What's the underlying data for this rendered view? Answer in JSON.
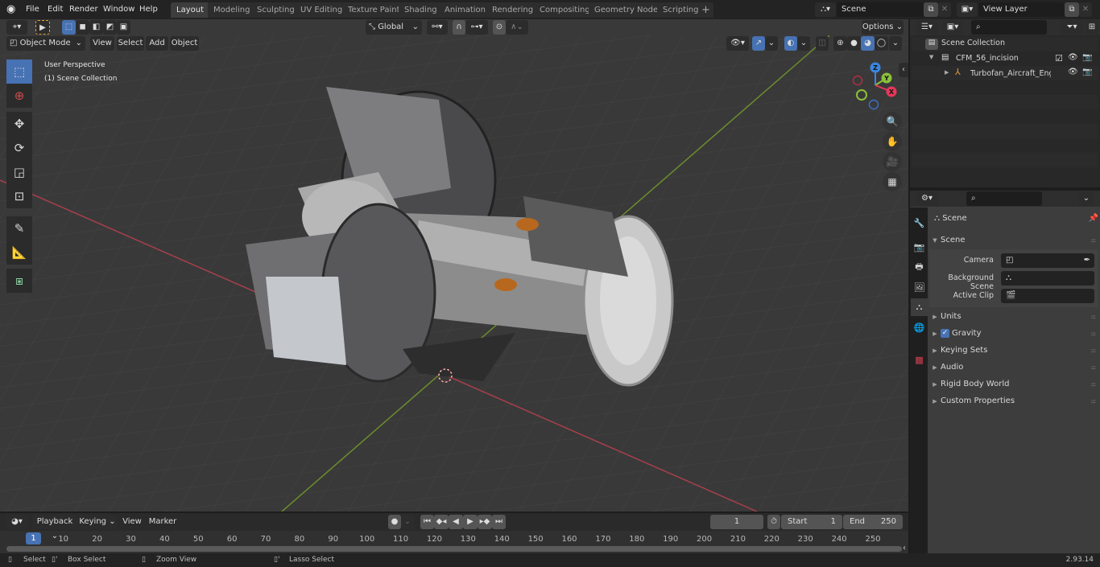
{
  "app": {
    "version": "2.93.14"
  },
  "topbar": {
    "menus": [
      "File",
      "Edit",
      "Render",
      "Window",
      "Help"
    ],
    "workspaces": [
      "Layout",
      "Modeling",
      "Sculpting",
      "UV Editing",
      "Texture Paint",
      "Shading",
      "Animation",
      "Rendering",
      "Compositing",
      "Geometry Nodes",
      "Scripting"
    ],
    "active_workspace": "Layout",
    "add_tab": "+",
    "scene_name": "Scene",
    "view_layer_name": "View Layer"
  },
  "viewport": {
    "mode": "Object Mode",
    "menus": [
      "View",
      "Select",
      "Add",
      "Object"
    ],
    "transform_orientation": "Global",
    "options_label": "Options",
    "overlay_text": {
      "line1": "User Perspective",
      "line2": "(1) Scene Collection"
    },
    "gizmo_axes": {
      "x": "X",
      "y": "Y",
      "z": "Z"
    },
    "colors": {
      "x_axis": "#e8375a",
      "y_axis": "#8bc03a",
      "z_axis": "#3a86e0",
      "active": "#4772b3"
    },
    "tools": [
      "select-box",
      "cursor",
      "move",
      "rotate",
      "scale",
      "transform",
      "annotate",
      "measure",
      "add-cube"
    ],
    "nav_buttons": [
      "zoom",
      "pan",
      "camera",
      "ortho-toggle"
    ]
  },
  "outliner": {
    "search_placeholder": "",
    "items": [
      {
        "label": "Scene Collection",
        "level": 0
      },
      {
        "label": "CFM_56_incision",
        "level": 1,
        "checked": true
      },
      {
        "label": "Turbofan_Aircraft_Engine",
        "level": 2
      }
    ]
  },
  "properties": {
    "search_placeholder": "",
    "context_label": "Scene",
    "panel_title": "Scene",
    "fields": [
      {
        "label": "Camera",
        "value": ""
      },
      {
        "label": "Background Scene",
        "value": ""
      },
      {
        "label": "Active Clip",
        "value": ""
      }
    ],
    "subpanels": [
      {
        "label": "Units"
      },
      {
        "label": "Gravity",
        "checkbox": true
      },
      {
        "label": "Keying Sets"
      },
      {
        "label": "Audio"
      },
      {
        "label": "Rigid Body World"
      },
      {
        "label": "Custom Properties"
      }
    ]
  },
  "timeline": {
    "menus": [
      "Playback",
      "Keying",
      "View",
      "Marker"
    ],
    "current_frame": "1",
    "start_label": "Start",
    "start": "1",
    "end_label": "End",
    "end": "250",
    "ticks": [
      "10",
      "20",
      "30",
      "40",
      "50",
      "60",
      "70",
      "80",
      "90",
      "100",
      "110",
      "120",
      "130",
      "140",
      "150",
      "160",
      "170",
      "180",
      "190",
      "200",
      "210",
      "220",
      "230",
      "240",
      "250"
    ],
    "playhead": "1"
  },
  "statusbar": {
    "hints": [
      "Select",
      "Box Select",
      "Zoom View",
      "Lasso Select"
    ]
  }
}
